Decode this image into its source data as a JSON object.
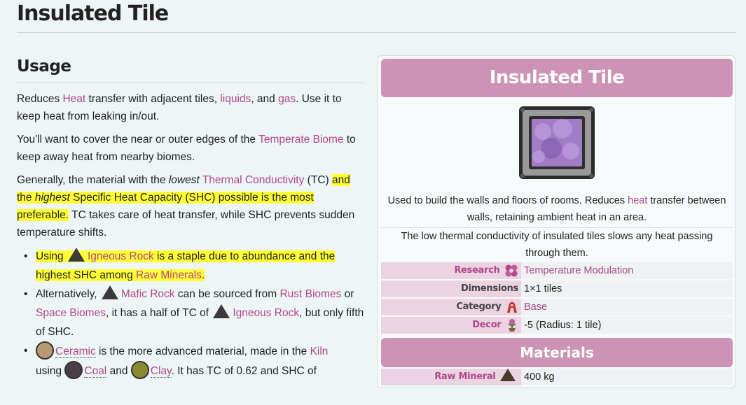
{
  "page": {
    "title": "Insulated Tile"
  },
  "usage": {
    "heading": "Usage",
    "p1": {
      "t1": "Reduces ",
      "heat": "Heat",
      "t2": " transfer with adjacent tiles, ",
      "liquids": "liquids",
      "t3": ", and ",
      "gas": "gas",
      "t4": ". Use it to keep heat from leaking in/out."
    },
    "p2": {
      "t1": "You'll want to cover the near or outer edges of the ",
      "link": "Temperate Biome",
      "t2": " to keep away heat from nearby biomes."
    },
    "p3": {
      "t1": "Generally, the material with the ",
      "lowest": "lowest",
      "t2": " ",
      "tc": "Thermal Conductivity",
      "t3": " (TC) ",
      "hl1": "and the ",
      "highest": "highest",
      "hl2": " Specific Heat Capacity (SHC) possible is the most preferable.",
      "t4": " TC takes care of heat transfer, while SHC prevents sudden temperature shifts."
    },
    "b1": {
      "using": "Using",
      "igneous": "Igneous Rock",
      "hl": " is a staple due to abundance and the highest SHC among ",
      "raw": "Raw Minerals",
      "dot": "."
    },
    "b2": {
      "t1": "Alternatively, ",
      "mafic": "Mafic Rock",
      "t2": " can be sourced from ",
      "rust": "Rust Biomes",
      "t3": " or ",
      "space": "Space Biomes",
      "t4": ", it has a half of TC of ",
      "igneous": "Igneous Rock",
      "t5": ", but only fifth of SHC."
    },
    "b3": {
      "ceramic": "Ceramic",
      "t1": " is the more advanced material, made in the ",
      "kiln": "Kiln",
      "t2": " using ",
      "coal": "Coal",
      "t3": " and ",
      "clay": "Clay",
      "t4": ". It has TC of 0.62 and SHC of"
    }
  },
  "infobox": {
    "title": "Insulated Tile",
    "desc1": {
      "t1": "Used to build the walls and floors of rooms. Reduces ",
      "heat": "heat",
      "t2": " transfer between walls, retaining ambient heat in an area."
    },
    "desc2": "The low thermal conductivity of insulated tiles slows any heat passing through them.",
    "rows": [
      {
        "label": "Research",
        "value": "Temperature Modulation",
        "icon": "research-icon"
      },
      {
        "label": "Dimensions",
        "value": "1×1 tiles",
        "icon": ""
      },
      {
        "label": "Category",
        "value": "Base",
        "icon": "base-category-icon"
      },
      {
        "label": "Decor",
        "value": "-5 (Radius: 1 tile)",
        "icon": "decor-icon"
      }
    ],
    "materials_heading": "Materials",
    "material": {
      "label": "Raw Mineral",
      "value": "400 kg",
      "icon": "raw-mineral-icon"
    }
  },
  "colors": {
    "accent": "#cc93b5",
    "link": "#b0478a",
    "highlight": "#ffff33"
  }
}
